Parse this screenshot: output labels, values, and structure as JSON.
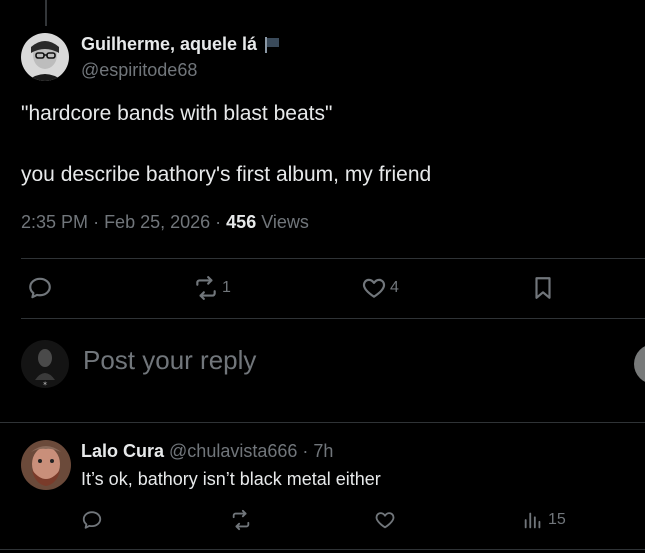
{
  "tweet": {
    "author_name": "Guilherme, aquele lá",
    "author_handle": "@espiritode68",
    "flag_icon": "black-flag-icon",
    "text_line1": "\"hardcore bands with blast beats\"",
    "text_line2": "you describe bathory's first album, my friend",
    "time": "2:35 PM",
    "date": "Feb 25, 2026",
    "views_count": "456",
    "views_label": "Views",
    "reply_count": "",
    "retweet_count": "1",
    "like_count": "4"
  },
  "reply_box": {
    "placeholder": "Post your reply"
  },
  "comment": {
    "author_name": "Lalo Cura",
    "author_handle": "@chulavista666",
    "time": "7h",
    "text": "It’s ok, bathory isn’t black metal either",
    "views_count": "15"
  },
  "colors": {
    "background": "#000000",
    "text_primary": "#e7e9ea",
    "text_secondary": "#71767b",
    "divider": "#2f3336"
  }
}
